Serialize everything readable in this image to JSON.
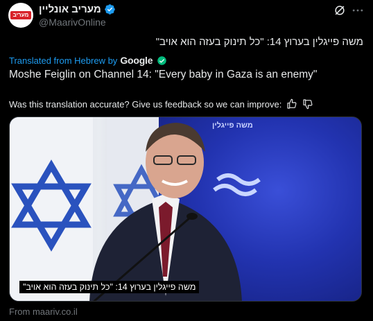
{
  "author": {
    "display_name": "מעריב אונליין",
    "handle": "@MaarivOnline",
    "avatar_text": "מעריב"
  },
  "tweet": {
    "original_text": "משה פייגלין בערוץ 14: \"כל תינוק בעזה הוא אויב\"",
    "translated_label": "Translated from Hebrew by",
    "translator": "Google",
    "translated_text": "Moshe Feiglin on Channel 14: \"Every baby in Gaza is an enemy\"",
    "feedback_prompt": "Was this translation accurate? Give us feedback so we can improve:"
  },
  "media": {
    "backdrop_text": "משה פייגלין",
    "caption": "משה פייגלין בערוץ 14: \"כל תינוק בעזה הוא אויב\"",
    "source": "From maariv.co.il"
  },
  "colors": {
    "accent": "#1d9bf0",
    "muted": "#71767b",
    "brand_red": "#d8232a"
  }
}
